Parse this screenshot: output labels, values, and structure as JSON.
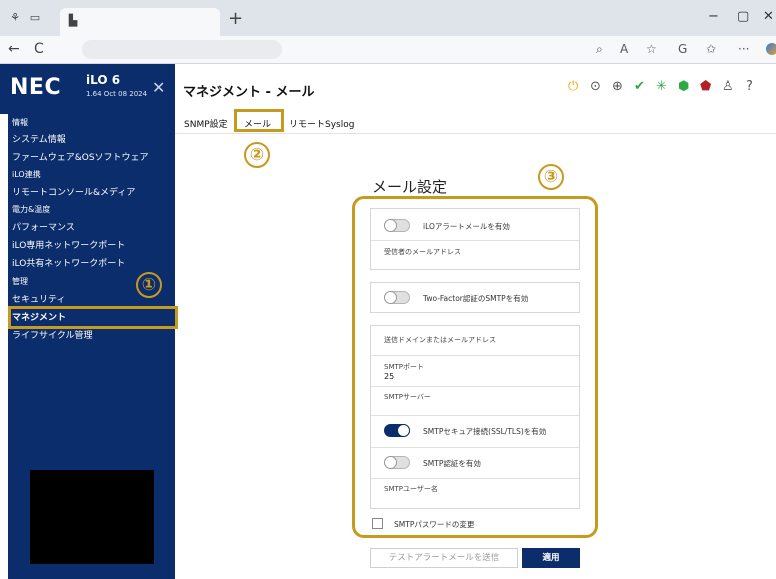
{
  "browser": {
    "new_tab_symbol": "+",
    "window_controls": [
      "−",
      "▢",
      "✕"
    ],
    "nav": {
      "back": "←",
      "reload": "C"
    }
  },
  "header": {
    "logo_text": "NEC",
    "product_name": "iLO 6",
    "product_version": "1.64 Oct 08 2024",
    "close_symbol": "✕",
    "page_title": "マネジメント - メール",
    "status_icon_colors": {
      "power": "#f0a500",
      "health": "#2eaa44",
      "security": "#b22222"
    }
  },
  "sidebar": {
    "items": [
      {
        "label": "情報",
        "size": "sm"
      },
      {
        "label": "システム情報"
      },
      {
        "label": "ファームウェア&OSソフトウェア"
      },
      {
        "label": "iLO連携",
        "size": "sm"
      },
      {
        "label": "リモートコンソール&メディア"
      },
      {
        "label": "電力&温度",
        "size": "sm"
      },
      {
        "label": "パフォーマンス"
      },
      {
        "label": "iLO専用ネットワークポート"
      },
      {
        "label": "iLO共有ネットワークポート"
      },
      {
        "label": "管理",
        "size": "sm"
      },
      {
        "label": "セキュリティ"
      },
      {
        "label": "マネジメント",
        "active": true
      },
      {
        "label": "ライフサイクル管理"
      }
    ],
    "annotation": "①"
  },
  "subtabs": {
    "items": [
      "SNMP設定",
      "メール",
      "リモートSyslog"
    ],
    "annotation": "②"
  },
  "mail_settings": {
    "title": "メール設定",
    "annotation": "③",
    "alert_mail_toggle": {
      "label": "iLOアラートメールを有効",
      "on": false
    },
    "recipient_label": "受信者のメールアドレス",
    "two_factor_toggle": {
      "label": "Two-Factor認証のSMTPを有効",
      "on": false
    },
    "sender_label": "送信ドメインまたはメールアドレス",
    "smtp_port_label": "SMTPポート",
    "smtp_port_value": "25",
    "smtp_server_label": "SMTPサーバー",
    "smtp_secure_toggle": {
      "label": "SMTPセキュア接続(SSL/TLS)を有効",
      "on": true
    },
    "smtp_auth_toggle": {
      "label": "SMTP認証を有効",
      "on": false
    },
    "smtp_user_label": "SMTPユーザー名",
    "change_password_label": "SMTPパスワードの変更",
    "send_test_button": "テストアラートメールを送信",
    "apply_button": "適用"
  }
}
